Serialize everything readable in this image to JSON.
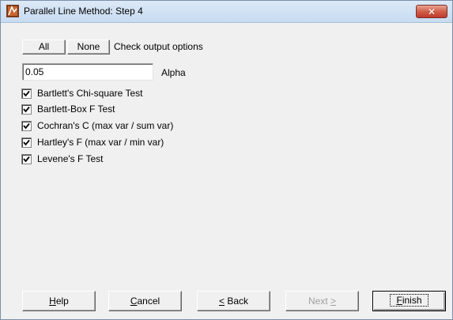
{
  "window": {
    "title": "Parallel Line Method: Step 4",
    "close_label": "✕"
  },
  "options_bar": {
    "all_label": "All",
    "none_label": "None",
    "hint": "Check output options"
  },
  "alpha": {
    "value": "0.05",
    "label": "Alpha"
  },
  "checks": [
    {
      "label": "Bartlett's Chi-square Test",
      "checked": true
    },
    {
      "label": "Bartlett-Box F Test",
      "checked": true
    },
    {
      "label": "Cochran's C (max var / sum var)",
      "checked": true
    },
    {
      "label": "Hartley's F (max var / min var)",
      "checked": true
    },
    {
      "label": "Levene's F Test",
      "checked": true
    }
  ],
  "footer": {
    "help": {
      "pre": "",
      "key": "H",
      "post": "elp"
    },
    "cancel": {
      "pre": "",
      "key": "C",
      "post": "ancel"
    },
    "back": {
      "pre": "",
      "key": "<",
      "post": " Back"
    },
    "next": {
      "pre": "Next ",
      "key": ">",
      "post": ""
    },
    "finish": {
      "pre": "",
      "key": "F",
      "post": "inish"
    }
  }
}
